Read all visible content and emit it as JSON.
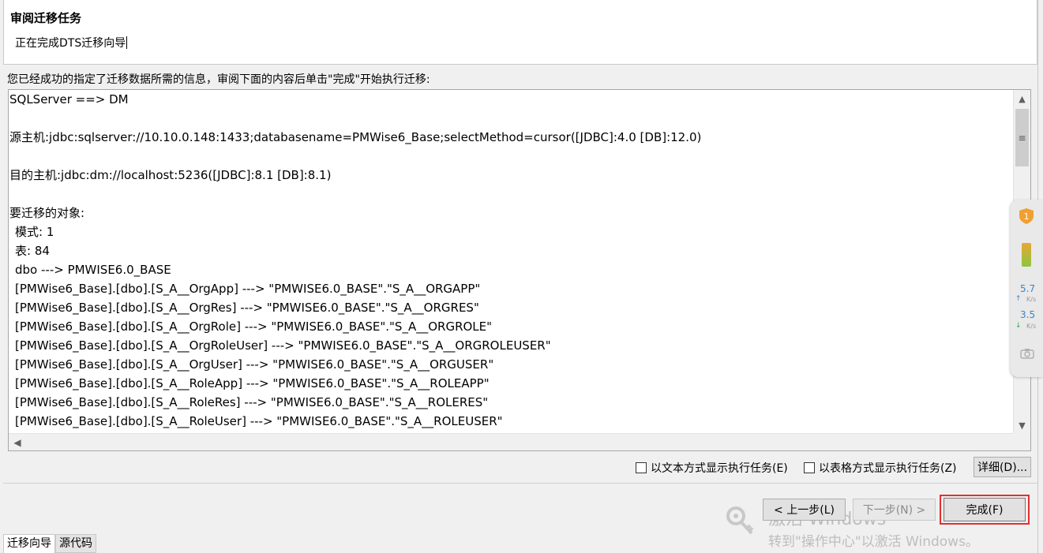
{
  "header": {
    "title": "审阅迁移任务",
    "subtitle": "正在完成DTS迁移向导"
  },
  "intro": "您已经成功的指定了迁移数据所需的信息，审阅下面的内容后单击\"完成\"开始执行迁移:",
  "summary_lines": [
    {
      "text": "SQLServer ==> DM",
      "indent": false
    },
    {
      "text": "",
      "indent": false
    },
    {
      "text": "源主机:jdbc:sqlserver://10.10.0.148:1433;databasename=PMWise6_Base;selectMethod=cursor([JDBC]:4.0 [DB]:12.0)",
      "indent": false
    },
    {
      "text": "",
      "indent": false
    },
    {
      "text": "目的主机:jdbc:dm://localhost:5236([JDBC]:8.1 [DB]:8.1)",
      "indent": false
    },
    {
      "text": "",
      "indent": false
    },
    {
      "text": "要迁移的对象:",
      "indent": false
    },
    {
      "text": "模式: 1",
      "indent": true
    },
    {
      "text": "表: 84",
      "indent": true
    },
    {
      "text": "dbo ---> PMWISE6.0_BASE",
      "indent": true
    },
    {
      "text": "[PMWise6_Base].[dbo].[S_A__OrgApp] ---> \"PMWISE6.0_BASE\".\"S_A__ORGAPP\"",
      "indent": true
    },
    {
      "text": "[PMWise6_Base].[dbo].[S_A__OrgRes] ---> \"PMWISE6.0_BASE\".\"S_A__ORGRES\"",
      "indent": true
    },
    {
      "text": "[PMWise6_Base].[dbo].[S_A__OrgRole] ---> \"PMWISE6.0_BASE\".\"S_A__ORGROLE\"",
      "indent": true
    },
    {
      "text": "[PMWise6_Base].[dbo].[S_A__OrgRoleUser] ---> \"PMWISE6.0_BASE\".\"S_A__ORGROLEUSER\"",
      "indent": true
    },
    {
      "text": "[PMWise6_Base].[dbo].[S_A__OrgUser] ---> \"PMWISE6.0_BASE\".\"S_A__ORGUSER\"",
      "indent": true
    },
    {
      "text": "[PMWise6_Base].[dbo].[S_A__RoleApp] ---> \"PMWISE6.0_BASE\".\"S_A__ROLEAPP\"",
      "indent": true
    },
    {
      "text": "[PMWise6_Base].[dbo].[S_A__RoleRes] ---> \"PMWISE6.0_BASE\".\"S_A__ROLERES\"",
      "indent": true
    },
    {
      "text": "[PMWise6_Base].[dbo].[S_A__RoleUser] ---> \"PMWISE6.0_BASE\".\"S_A__ROLEUSER\"",
      "indent": true
    }
  ],
  "options": {
    "text_mode_label": "以文本方式显示执行任务(E)",
    "table_mode_label": "以表格方式显示执行任务(Z)",
    "detail_button": "详细(D)..."
  },
  "buttons": {
    "back": "< 上一步(L)",
    "next": "下一步(N) >",
    "finish": "完成(F)"
  },
  "tabs": [
    "迁移向导",
    "源代码"
  ],
  "watermark": {
    "line1": "激活 Windows",
    "line2": "转到\"操作中心\"以激活 Windows。"
  },
  "widget": {
    "badge": "1",
    "upload_value": "5.7",
    "download_value": "3.5",
    "unit": "K/s",
    "upload_color": "#3a84c7",
    "download_color": "#2aa84a"
  },
  "icons": {
    "scroll_up": "▲",
    "scroll_down": "▼",
    "scroll_left": "◀",
    "scroll_right": "▶",
    "thumb_grip": "≡"
  },
  "colors": {
    "highlight": "#e0312f"
  }
}
